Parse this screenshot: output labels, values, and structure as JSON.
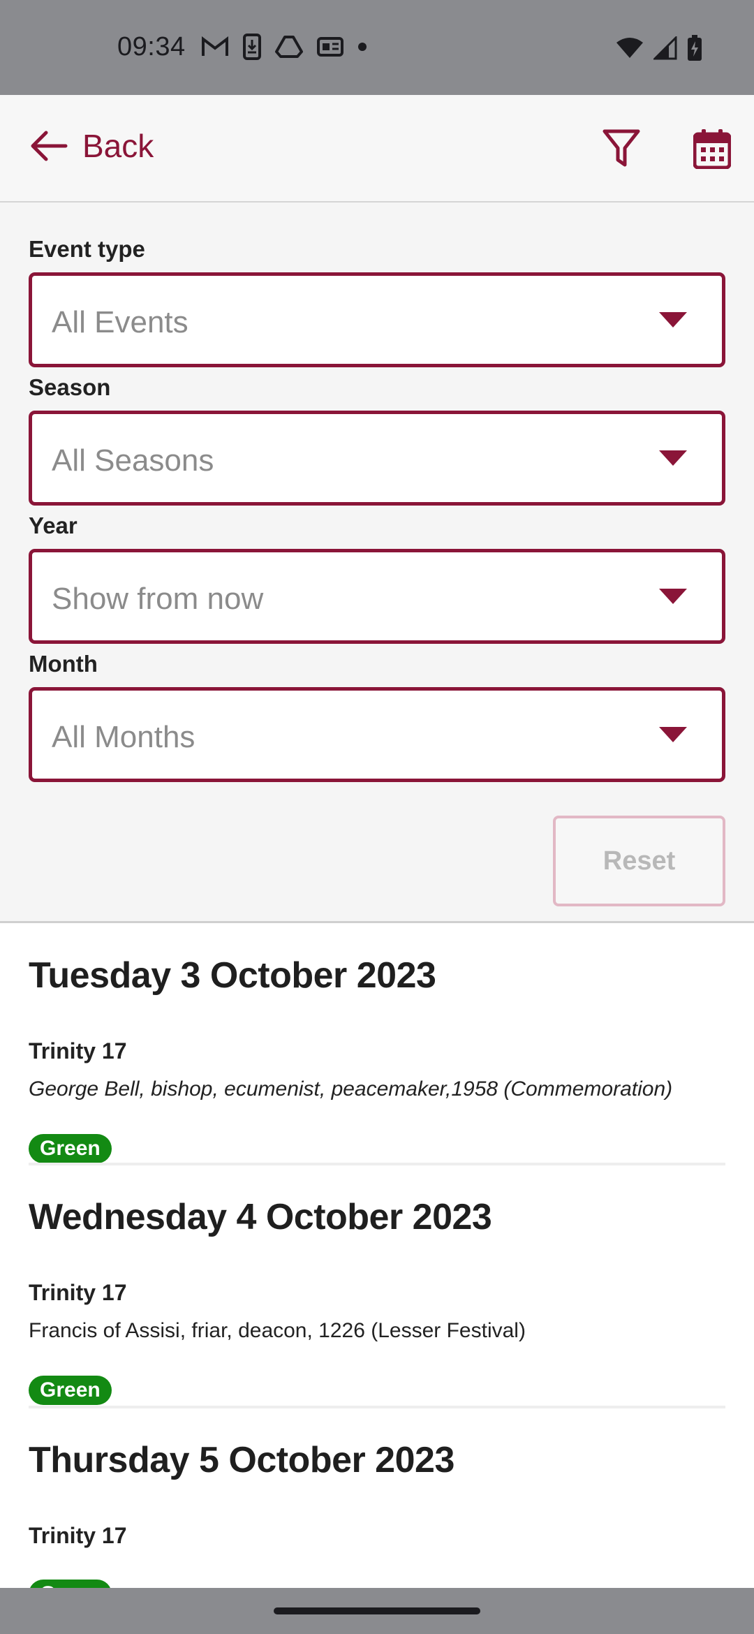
{
  "status_bar": {
    "time": "09:34",
    "left_icons": [
      "gmail-icon",
      "download-icon",
      "drive-icon",
      "news-icon",
      "dot-icon"
    ],
    "right_icons": [
      "wifi-icon",
      "signal-icon",
      "battery-charging-icon"
    ]
  },
  "app_bar": {
    "back_label": "Back",
    "actions": [
      "filter-icon",
      "calendar-icon"
    ],
    "accent_color": "#8a1538"
  },
  "filters": {
    "event_type": {
      "label": "Event type",
      "value": "All Events"
    },
    "season": {
      "label": "Season",
      "value": "All Seasons"
    },
    "year": {
      "label": "Year",
      "value": "Show from now"
    },
    "month": {
      "label": "Month",
      "value": "All Months"
    },
    "reset_label": "Reset"
  },
  "events": [
    {
      "date": "Tuesday 3 October 2023",
      "season": "Trinity 17",
      "description": "George Bell, bishop, ecumenist, peacemaker,1958 (Commemoration)",
      "colour": "Green"
    },
    {
      "date": "Wednesday 4 October 2023",
      "season": "Trinity 17",
      "description": "Francis of Assisi, friar, deacon, 1226 (Lesser Festival)",
      "colour": "Green"
    },
    {
      "date": "Thursday 5 October 2023",
      "season": "Trinity 17",
      "colour": "Green"
    }
  ],
  "colors": {
    "liturgical_green": "#138a13",
    "status_bar": "#8a8b8f"
  }
}
